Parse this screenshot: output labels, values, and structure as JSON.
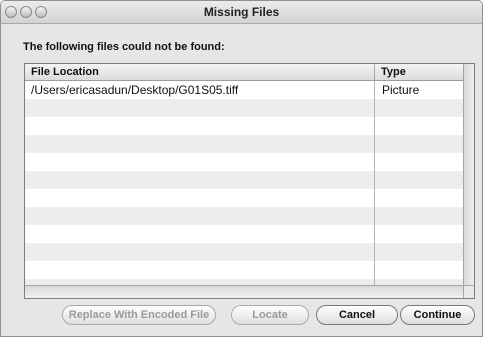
{
  "window": {
    "title": "Missing Files"
  },
  "prompt": "The following files could not be found:",
  "table": {
    "columns": [
      "File Location",
      "Type"
    ],
    "rows": [
      {
        "location": "/Users/ericasadun/Desktop/G01S05.tiff",
        "type": "Picture"
      }
    ]
  },
  "buttons": {
    "replace": "Replace With Encoded File",
    "locate": "Locate",
    "cancel": "Cancel",
    "continue": "Continue"
  }
}
